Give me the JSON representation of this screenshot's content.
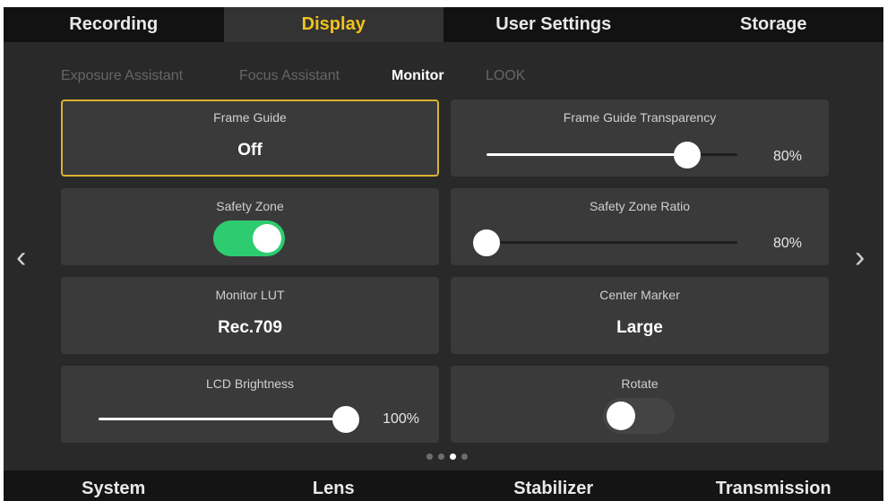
{
  "top_tabs": [
    {
      "label": "Recording"
    },
    {
      "label": "Display",
      "active": true
    },
    {
      "label": "User Settings"
    },
    {
      "label": "Storage"
    }
  ],
  "sub_tabs": [
    {
      "label": "Exposure Assistant"
    },
    {
      "label": "Focus Assistant"
    },
    {
      "label": "Monitor",
      "active": true
    },
    {
      "label": "LOOK"
    }
  ],
  "settings": {
    "frame_guide": {
      "label": "Frame Guide",
      "value": "Off"
    },
    "frame_guide_transparency": {
      "label": "Frame Guide Transparency",
      "value_text": "80%",
      "level": 0.8
    },
    "safety_zone": {
      "label": "Safety Zone",
      "on": true
    },
    "safety_zone_ratio": {
      "label": "Safety Zone Ratio",
      "value_text": "80%",
      "level": 0.0
    },
    "monitor_lut": {
      "label": "Monitor LUT",
      "value": "Rec.709"
    },
    "center_marker": {
      "label": "Center Marker",
      "value": "Large"
    },
    "lcd_brightness": {
      "label": "LCD Brightness",
      "value_text": "100%",
      "level": 1.0
    },
    "rotate": {
      "label": "Rotate",
      "on": false
    }
  },
  "navigation": {
    "prev_icon": "chevron-left-icon",
    "next_icon": "chevron-right-icon"
  },
  "pager": {
    "pages": 4,
    "current_page": 3
  },
  "bottom_tabs": [
    {
      "label": "System"
    },
    {
      "label": "Lens"
    },
    {
      "label": "Stabilizer"
    },
    {
      "label": "Transmission"
    }
  ],
  "colors": {
    "accent": "#f1c21b",
    "selected_border": "#d9b233",
    "toggle_on": "#2ecc71",
    "tile_background": "#3a3a3a",
    "screen_background": "#292929"
  }
}
